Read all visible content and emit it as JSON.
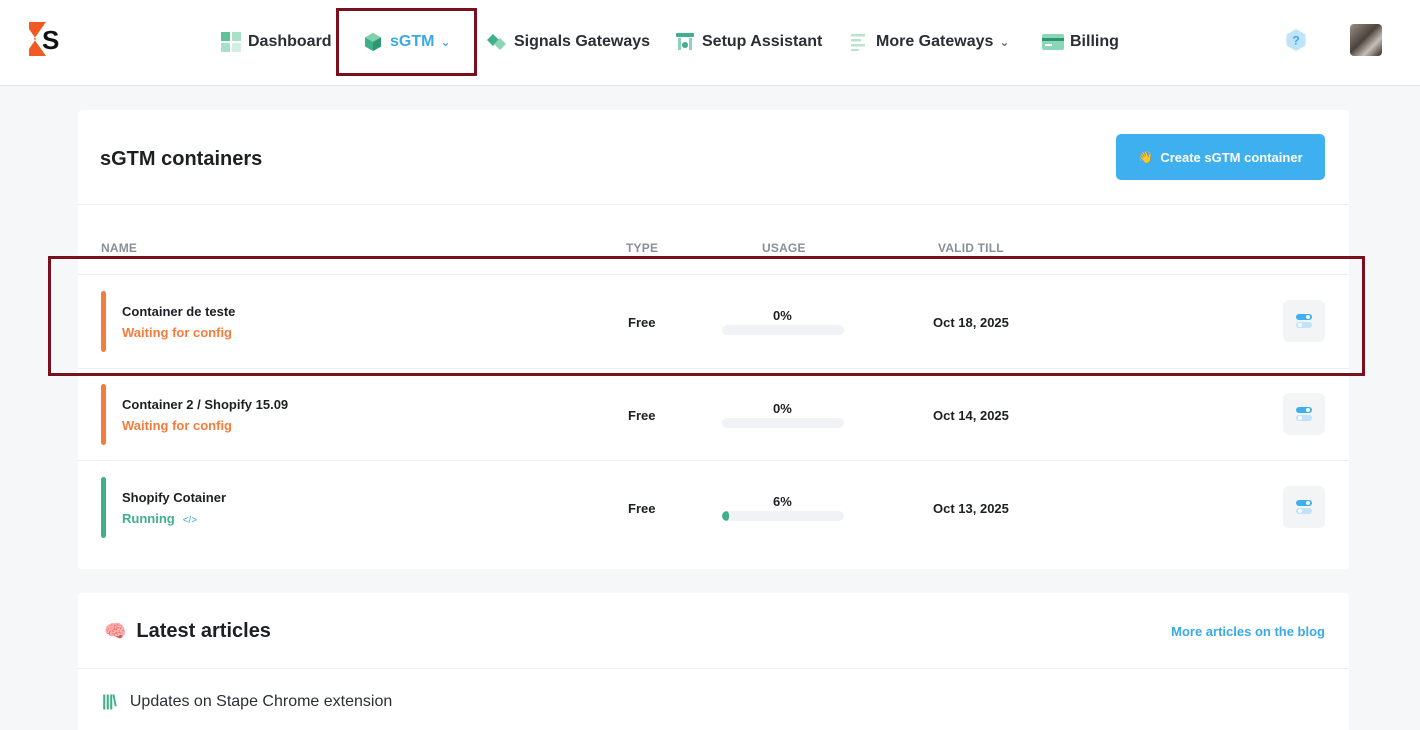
{
  "nav": {
    "items": [
      {
        "label": "Dashboard"
      },
      {
        "label": "sGTM"
      },
      {
        "label": "Signals Gateways"
      },
      {
        "label": "Setup Assistant"
      },
      {
        "label": "More Gateways"
      },
      {
        "label": "Billing"
      }
    ]
  },
  "containers": {
    "title": "sGTM containers",
    "create_label": "Create sGTM container",
    "columns": {
      "name": "NAME",
      "type": "TYPE",
      "usage": "USAGE",
      "valid_till": "VALID TILL"
    },
    "rows": [
      {
        "name": "Container de teste",
        "status": "Waiting for config",
        "type": "Free",
        "usage_label": "0%",
        "usage_fraction": 0.0,
        "valid_till": "Oct 18, 2025",
        "status_color": "#f47c3c"
      },
      {
        "name": "Container 2 / Shopify 15.09",
        "status": "Waiting for config",
        "type": "Free",
        "usage_label": "0%",
        "usage_fraction": 0.0,
        "valid_till": "Oct 14, 2025",
        "status_color": "#f47c3c"
      },
      {
        "name": "Shopify Cotainer",
        "status": "Running",
        "type": "Free",
        "usage_label": "6%",
        "usage_fraction": 0.06,
        "valid_till": "Oct 13, 2025",
        "status_color": "#3fb08a"
      }
    ]
  },
  "articles": {
    "title": "Latest articles",
    "more_link": "More articles on the blog",
    "items": [
      {
        "title": "Updates on Stape Chrome extension"
      }
    ]
  },
  "colors": {
    "accent": "#3fb0ef",
    "highlight": "#7a0f1d",
    "warning": "#f47c3c",
    "success": "#3fb08a"
  }
}
